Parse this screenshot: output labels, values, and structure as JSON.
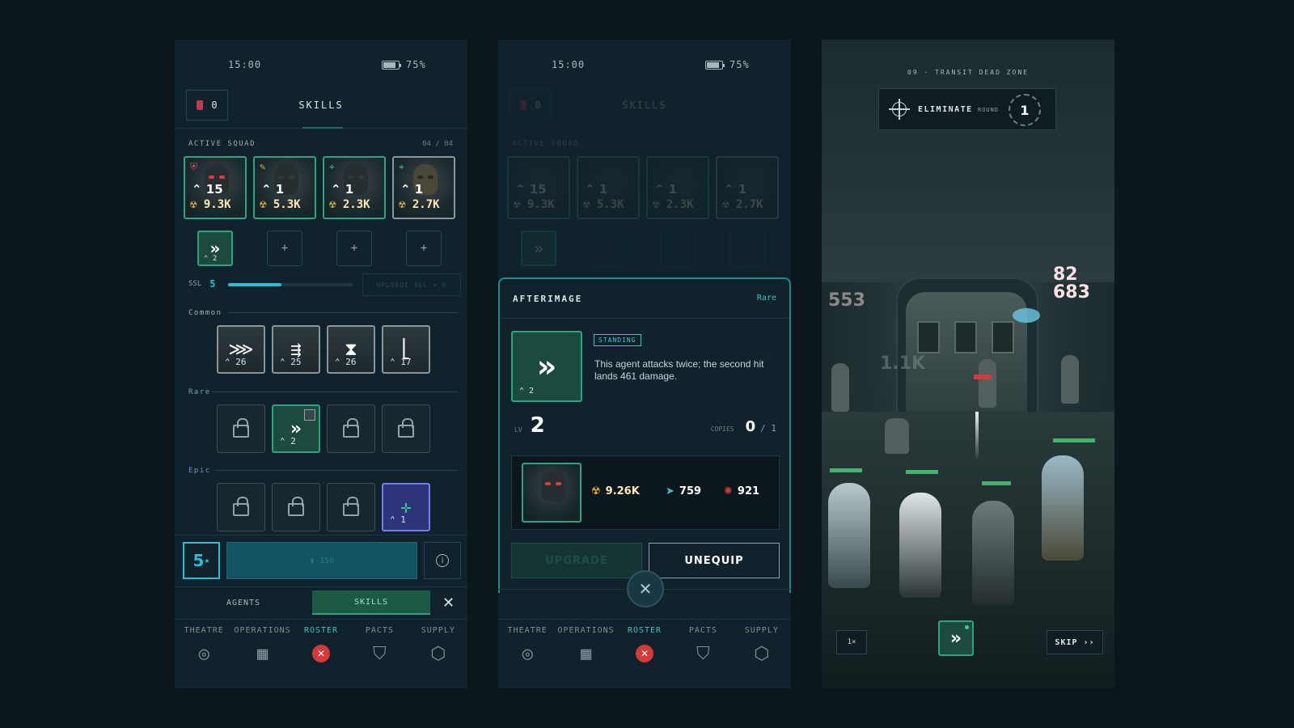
{
  "status": {
    "time": "15:00",
    "battery": "75%",
    "battery_level": 0.75
  },
  "header": {
    "tokens": "0",
    "title": "SKILLS"
  },
  "squad": {
    "label": "ACTIVE SQUAD",
    "count": "04 / 04",
    "agents": [
      {
        "level": "15",
        "power": "9.3K",
        "role_icon": "shield-icon"
      },
      {
        "level": "1",
        "power": "5.3K",
        "role_icon": "pencil-icon"
      },
      {
        "level": "1",
        "power": "2.3K",
        "role_icon": "crosshair-icon"
      },
      {
        "level": "1",
        "power": "2.7K",
        "role_icon": "crosshair-icon"
      }
    ]
  },
  "equipped_slots": {
    "first_count": "2"
  },
  "ssl": {
    "label": "SSL",
    "value": "5",
    "progress": 0.43,
    "upgrade_all": "UPGRADE ALL  ×  0"
  },
  "sections": {
    "common": {
      "label": "Common",
      "counts": [
        "26",
        "25",
        "26",
        "17"
      ]
    },
    "rare": {
      "label": "Rare",
      "active_count": "2"
    },
    "epic": {
      "label": "Epic",
      "active_count": "1"
    }
  },
  "footer": {
    "star_level": "5",
    "star_sup": "★",
    "action_label": "▮ 350"
  },
  "tabs": {
    "agents": "AGENTS",
    "skills": "SKILLS"
  },
  "nav": [
    {
      "label": "THEATRE",
      "icon": "target-icon"
    },
    {
      "label": "OPERATIONS",
      "icon": "map-icon"
    },
    {
      "label": "ROSTER",
      "icon": "roster-icon"
    },
    {
      "label": "PACTS",
      "icon": "shields-icon"
    },
    {
      "label": "SUPPLY",
      "icon": "crate-icon"
    }
  ],
  "modal": {
    "name": "AFTERIMAGE",
    "rarity": "Rare",
    "tag": "STANDING",
    "description": "This agent attacks twice; the second hit lands 461 damage.",
    "skill_count": "2",
    "lv_label": "LV",
    "level": "2",
    "copies_label": "COPIES",
    "copies": "0",
    "copies_max": "/ 1",
    "equipped_agent": {
      "power": "9.26K",
      "speed": "759",
      "defense": "921"
    },
    "upgrade": "UPGRADE",
    "unequip": "UNEQUIP"
  },
  "battle": {
    "zone": "09 · TRANSIT DEAD ZONE",
    "objective": "ELIMINATE",
    "round_label": "ROUND",
    "round": "1",
    "damage_numbers": [
      "553",
      "1.1K",
      "82",
      "683"
    ],
    "speed": "1×",
    "skip": "SKIP ››"
  }
}
